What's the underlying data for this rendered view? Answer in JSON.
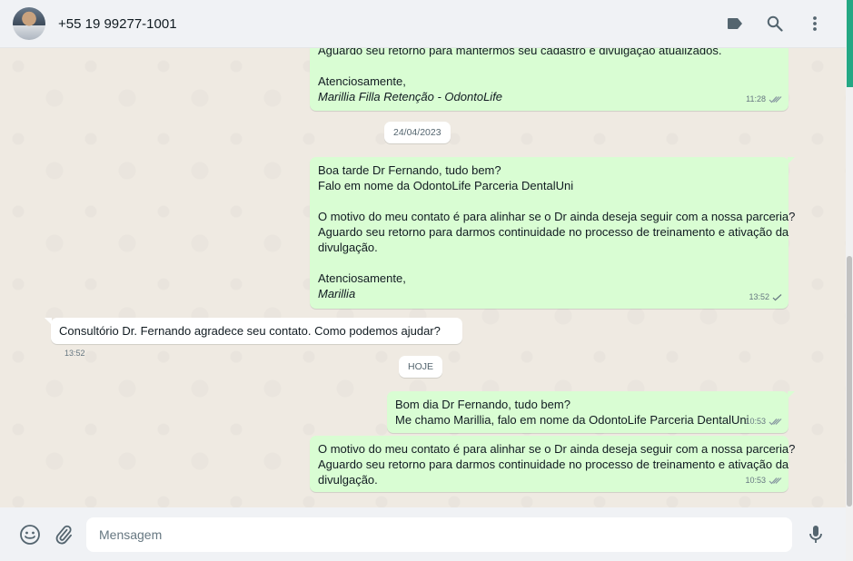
{
  "header": {
    "contact_name": "+55 19 99277-1001",
    "icons": [
      "label-icon",
      "search-icon",
      "menu-icon"
    ]
  },
  "colors": {
    "outgoing_bubble": "#d9fdd3",
    "incoming_bubble": "#ffffff",
    "chat_background": "#efeae2",
    "tick_read": "#53bdeb",
    "tick_sent": "#8696a0"
  },
  "messages": {
    "m1": {
      "lines": [
        "Aguardo seu retorno para mantermos seu cadastro e divulgação atualizados.",
        "",
        "Atenciosamente,",
        "Marillia Filla Retenção - OdontoLife"
      ],
      "time": "11:28",
      "status": "read"
    },
    "date1": "24/04/2023",
    "m2": {
      "lines": [
        "Boa tarde Dr Fernando, tudo bem?",
        "Falo em nome da OdontoLife Parceria DentalUni",
        "",
        "O motivo do meu contato é para alinhar se o Dr ainda deseja seguir com a nossa parceria?",
        "Aguardo seu retorno para darmos continuidade no processo de treinamento e ativação da",
        "divulgação.",
        "",
        "Atenciosamente,",
        "Marillia"
      ],
      "time": "13:52",
      "status": "sent"
    },
    "m3": {
      "text": "Consultório Dr. Fernando agradece seu contato. Como podemos ajudar?",
      "time": "13:52"
    },
    "date2": "HOJE",
    "m4": {
      "lines": [
        "Bom dia Dr Fernando, tudo bem?",
        "Me chamo Marillia, falo em nome da OdontoLife Parceria DentalUni"
      ],
      "time": "10:53",
      "status": "read"
    },
    "m5": {
      "lines": [
        "O motivo do meu contato é para alinhar se o Dr ainda deseja seguir com a nossa parceria?",
        "Aguardo seu retorno para darmos continuidade no processo de treinamento e ativação da",
        "divulgação."
      ],
      "time": "10:53",
      "status": "read"
    }
  },
  "composer": {
    "placeholder": "Mensagem",
    "icons": [
      "emoji-icon",
      "attach-icon",
      "microphone-icon"
    ]
  }
}
